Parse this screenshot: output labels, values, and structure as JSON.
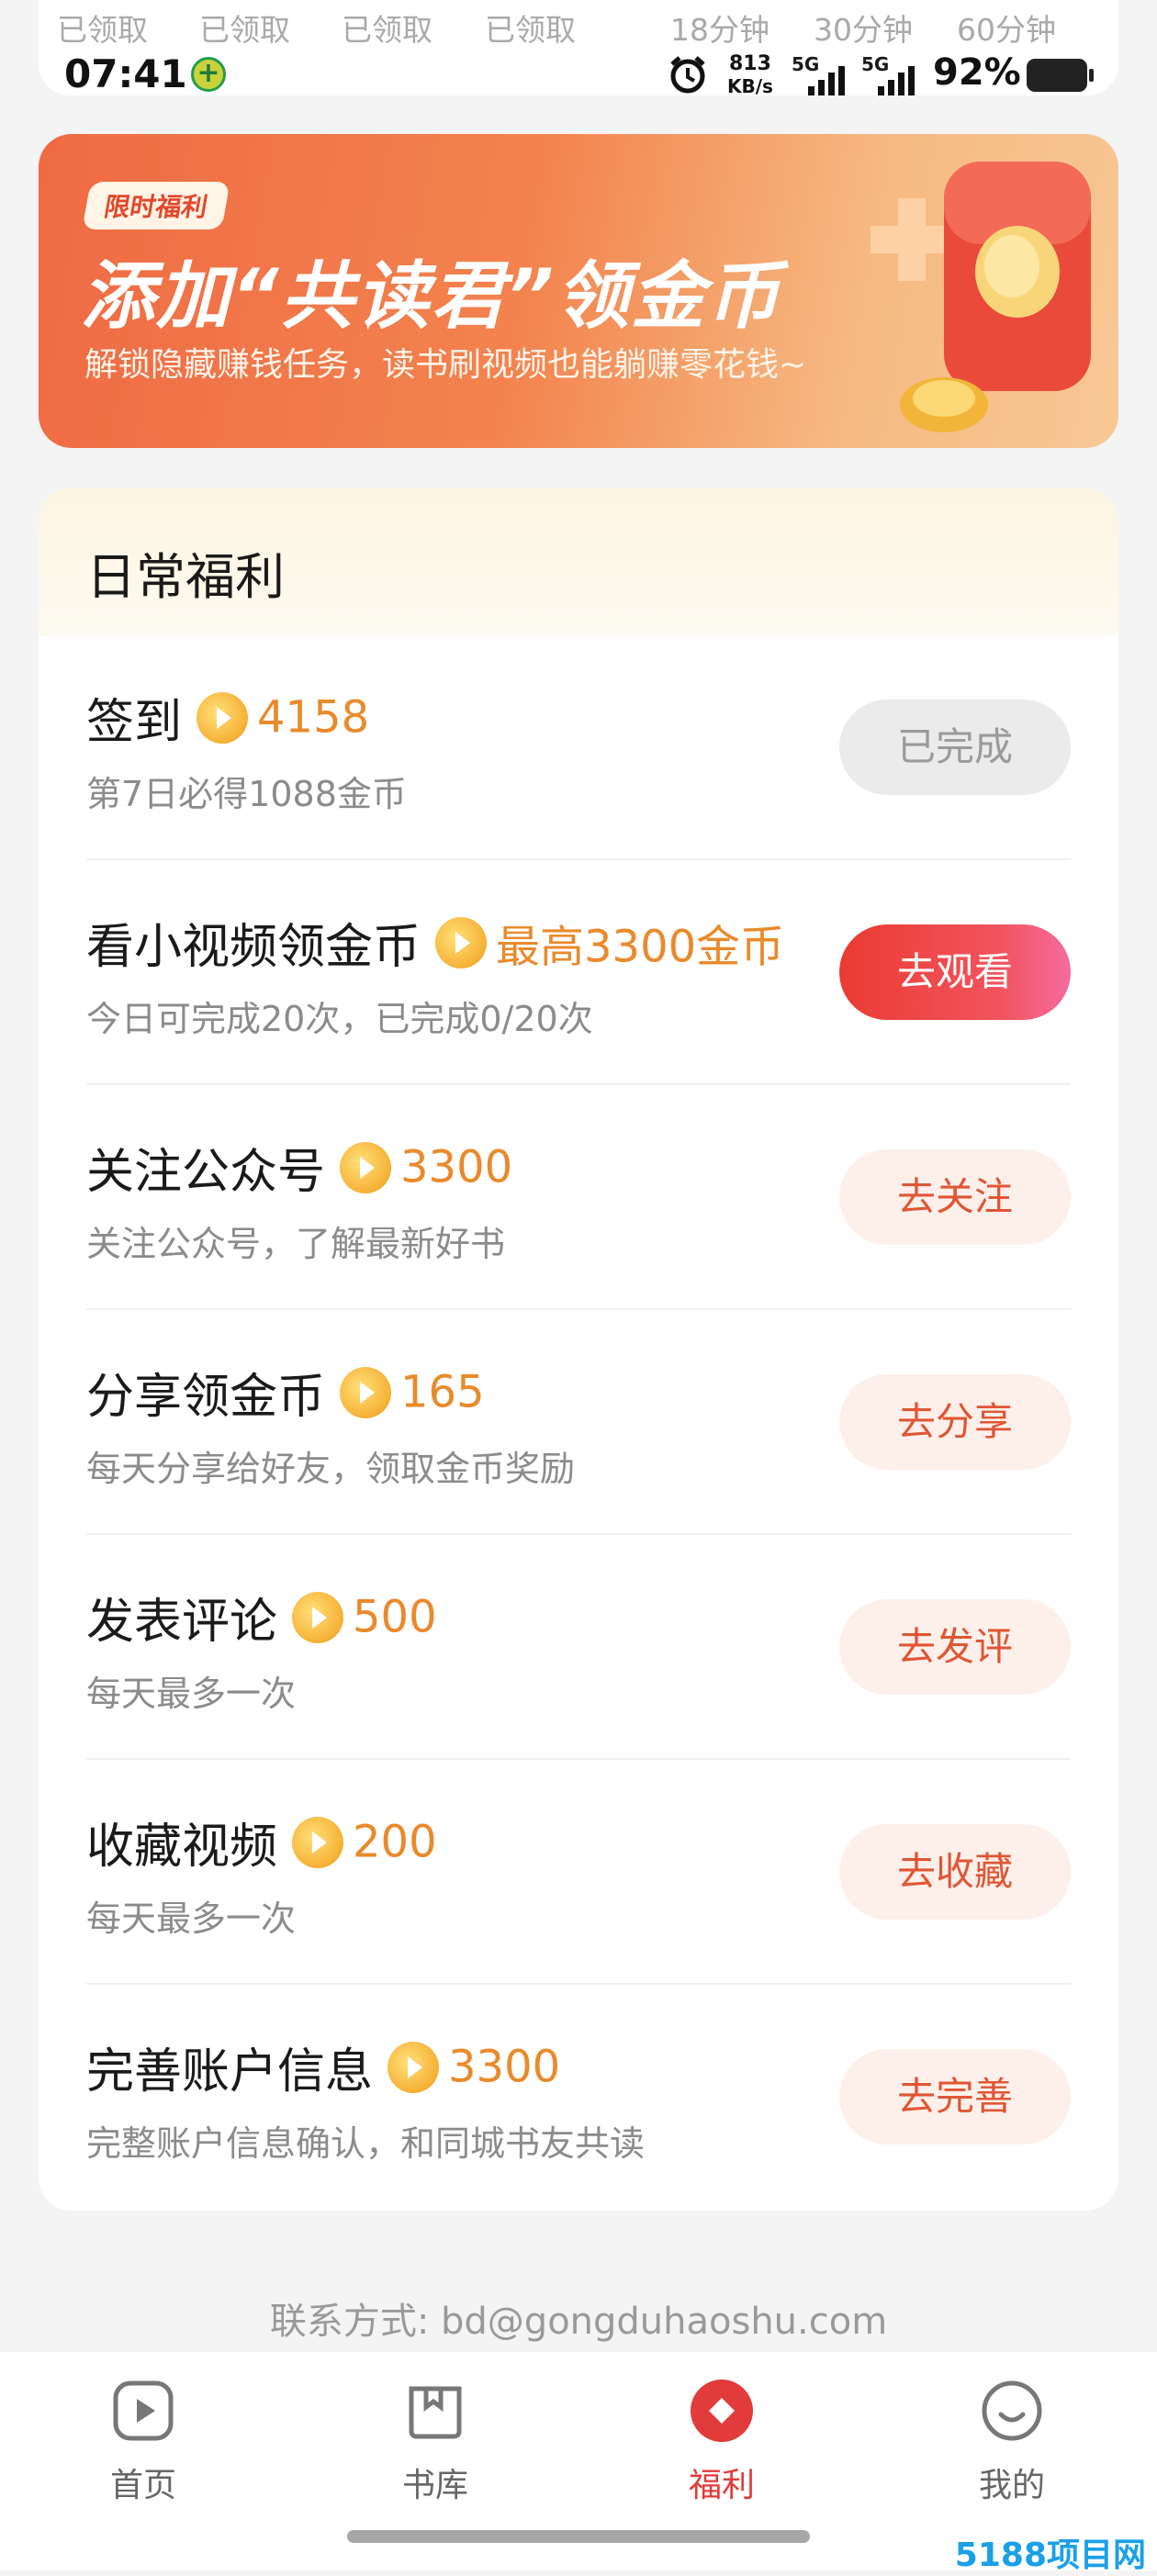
{
  "status_bar": {
    "claim_labels": [
      "已领取",
      "已领取",
      "已领取",
      "已领取",
      "18分钟",
      "30分钟",
      "60分钟"
    ],
    "time": "07:41",
    "alarm_icon": "alarm-icon",
    "net_speed_value": "813",
    "net_speed_unit": "KB/s",
    "signal1": "5G",
    "signal2": "5G",
    "battery": "92%"
  },
  "banner": {
    "tag": "限时福利",
    "title": "添加“共读君”领金币",
    "subtitle": "解锁隐藏赚钱任务，读书刷视频也能躺赚零花钱~"
  },
  "daily": {
    "title": "日常福利",
    "tasks": [
      {
        "name": "签到",
        "reward": "4158",
        "desc": "第7日必得1088金币",
        "button": "已完成"
      },
      {
        "name": "看小视频领金币",
        "reward": "最高3300金币",
        "desc": "今日可完成20次，已完成0/20次",
        "button": "去观看"
      },
      {
        "name": "关注公众号",
        "reward": "3300",
        "desc": "关注公众号，了解最新好书",
        "button": "去关注"
      },
      {
        "name": "分享领金币",
        "reward": "165",
        "desc": "每天分享给好友，领取金币奖励",
        "button": "去分享"
      },
      {
        "name": "发表评论",
        "reward": "500",
        "desc": "每天最多一次",
        "button": "去发评"
      },
      {
        "name": "收藏视频",
        "reward": "200",
        "desc": "每天最多一次",
        "button": "去收藏"
      },
      {
        "name": "完善账户信息",
        "reward": "3300",
        "desc": "完整账户信息确认，和同城书友共读",
        "button": "去完善"
      }
    ]
  },
  "contact": "联系方式: bd@gongduhaoshu.com",
  "nav": [
    {
      "label": "首页",
      "icon": "play-icon"
    },
    {
      "label": "书库",
      "icon": "library-icon"
    },
    {
      "label": "福利",
      "icon": "welfare-icon"
    },
    {
      "label": "我的",
      "icon": "profile-icon"
    }
  ],
  "watermark": "5188项目网",
  "colors": {
    "accent": "#e23b3b",
    "reward": "#e98a2b",
    "banner_start": "#ef6a44",
    "banner_end": "#f7c896"
  }
}
